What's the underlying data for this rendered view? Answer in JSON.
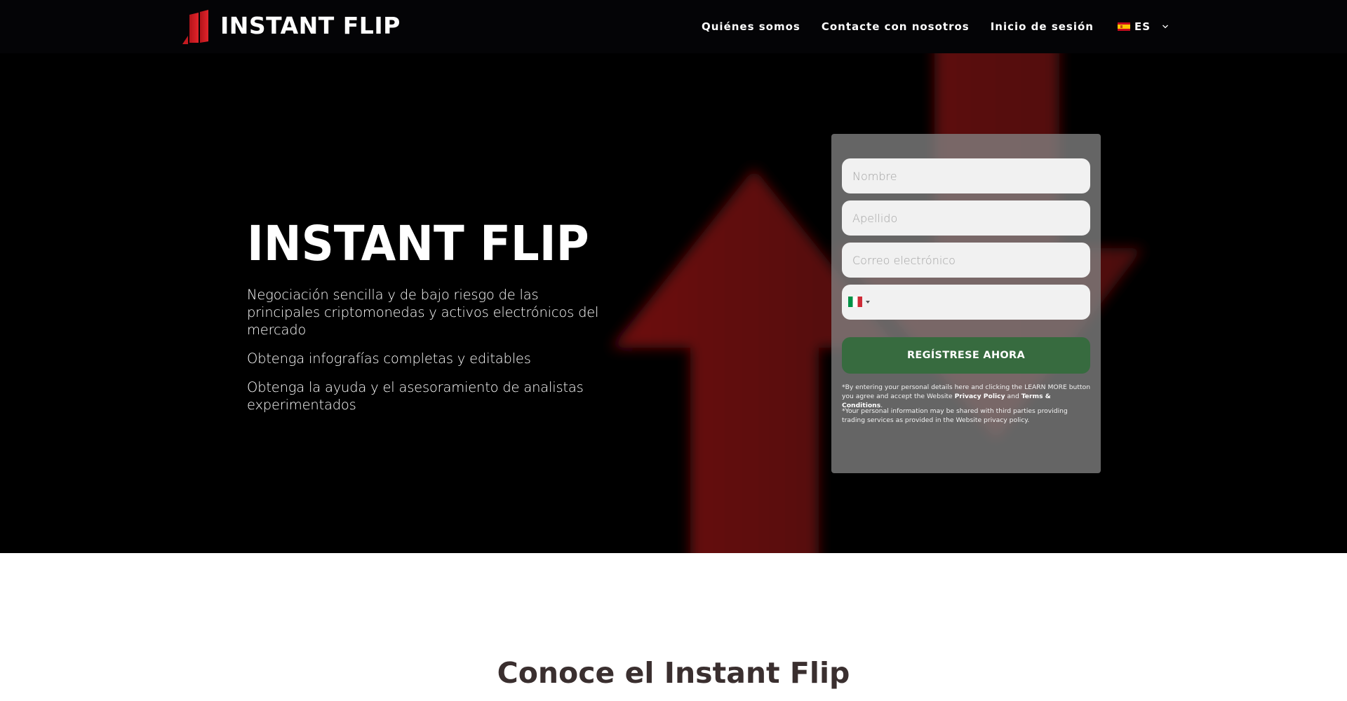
{
  "brand": {
    "name": "INSTANT FLIP",
    "logo_icon": "red-bars-logo-icon",
    "logo_color": "#d8191f"
  },
  "nav": {
    "items": [
      {
        "label": "Quiénes somos"
      },
      {
        "label": "Contacte con nosotros"
      },
      {
        "label": "Inicio de sesión"
      }
    ],
    "language": {
      "label": "ES",
      "flag": "spain-flag-icon",
      "chevron": "chevron-down-icon"
    }
  },
  "hero": {
    "title": "INSTANT FLIP",
    "bullets": [
      "Negociación sencilla y de bajo riesgo de las principales criptomonedas y activos electrónicos del mercado",
      "Obtenga infografías completas y editables",
      "Obtenga la ayuda y el asesoramiento de analistas experimentados"
    ],
    "background": {
      "arrow_up_color": "#5e0c0e",
      "arrow_down_color": "#560b0d"
    }
  },
  "form": {
    "first_name": {
      "placeholder": "Nombre",
      "value": ""
    },
    "last_name": {
      "placeholder": "Apellido",
      "value": ""
    },
    "email": {
      "placeholder": "Correo electrónico",
      "value": ""
    },
    "phone": {
      "country_flag": "italy-flag-icon",
      "value": ""
    },
    "submit_label": "REGÍSTRESE AHORA",
    "submit_color": "#376b3f",
    "disclaimer1": {
      "prefix": "*By entering your personal details here and clicking the LEARN MORE button you agree and accept the Website ",
      "privacy_link": "Privacy Policy",
      "middle": " and ",
      "terms_link": "Terms & Conditions",
      "suffix": "."
    },
    "disclaimer2": "*Your personal information may be shared with third parties providing trading services as provided in the Website privacy policy."
  },
  "section": {
    "title": "Conoce el Instant Flip"
  }
}
